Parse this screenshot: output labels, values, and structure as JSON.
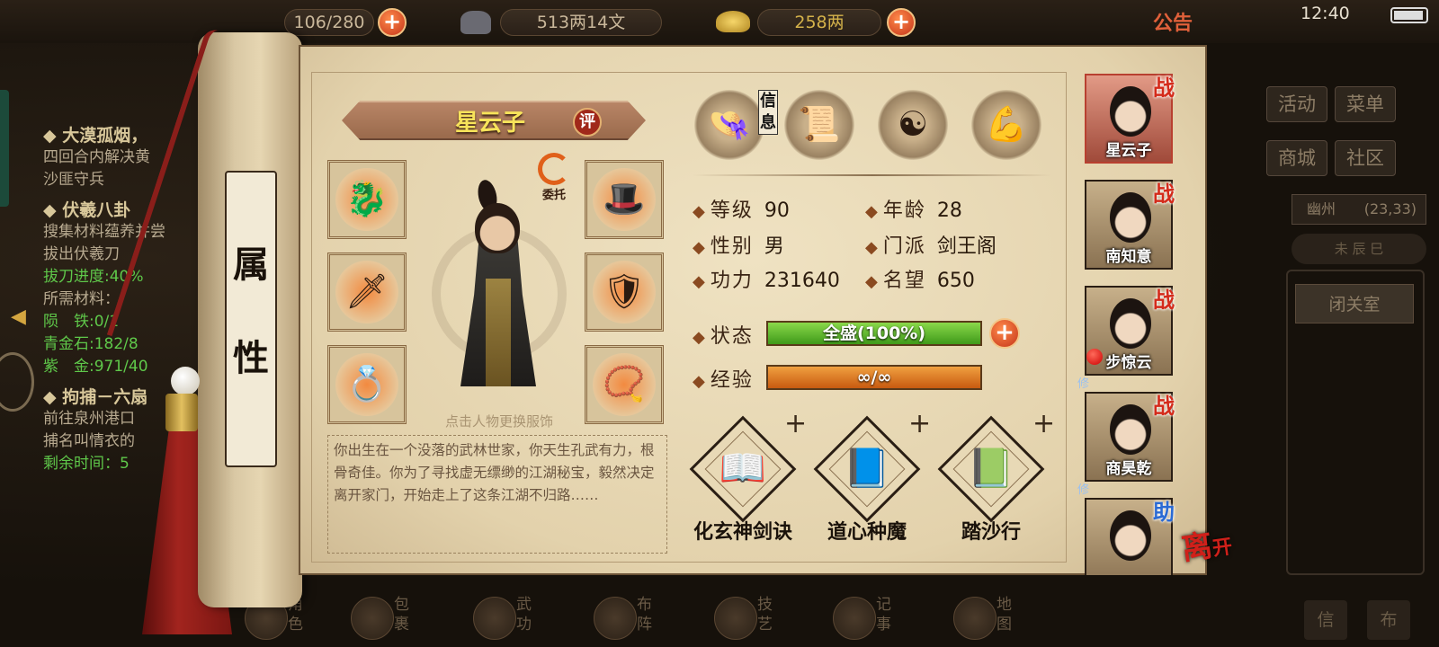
{
  "topbar": {
    "stamina": "106/280",
    "coins": "513两14文",
    "gold": "258两",
    "notice": "公告",
    "time": "12:40"
  },
  "quests": [
    {
      "title": "◆ 大漠孤烟，",
      "lines": [
        "四回合内解决黄",
        "沙匪守兵"
      ]
    },
    {
      "title": "◆ 伏羲八卦",
      "lines": [
        "搜集材料蕴养并尝",
        "拔出伏羲刀"
      ],
      "green_lines": [
        "拔刀进度:40%"
      ],
      "after": [
        "所需材料："
      ],
      "materials": [
        "陨　铁:0/1",
        "青金石:182/8",
        "紫　金:971/40"
      ]
    },
    {
      "title": "◆ 拘捕－六扇",
      "lines": [
        "前往泉州港口",
        "捕名叫情衣的"
      ],
      "timer": "剩余时间：5"
    }
  ],
  "side_menu": {
    "activity": "活动",
    "menu": "菜单",
    "shop": "商城",
    "community": "社区",
    "location_name": "幽州",
    "location_coords": "(23,33)",
    "shichen": "未 辰 巳",
    "seclusion": "闭关室",
    "letter": "信",
    "bag": "布"
  },
  "bottom_nav": [
    "角色",
    "包裹",
    "武功",
    "布阵",
    "技艺",
    "记事",
    "地图"
  ],
  "scroll_label": [
    "属",
    "性"
  ],
  "character": {
    "name": "星云子",
    "rate_label": "评",
    "entrust_label": "委托",
    "change_hint": "点击人物更换服饰",
    "bio": "你出生在一个没落的武林世家，你天生孔武有力，根骨奇佳。你为了寻找虚无缥缈的江湖秘宝，毅然决定离开家门，开始走上了这条江湖不归路……"
  },
  "tabs": {
    "info_label": "信息",
    "icons": [
      "info-hat-icon",
      "scroll-manual-icon",
      "bagua-icon",
      "meridian-body-icon"
    ]
  },
  "stats": {
    "level_label": "等级",
    "level": "90",
    "age_label": "年龄",
    "age": "28",
    "gender_label": "性别",
    "gender": "男",
    "sect_label": "门派",
    "sect": "剑王阁",
    "power_label": "功力",
    "power": "231640",
    "fame_label": "名望",
    "fame": "650",
    "state_label": "状态",
    "state": "全盛(100%)",
    "state_pct": 100,
    "exp_label": "经验",
    "exp": "∞/∞",
    "exp_pct": 100
  },
  "skills": [
    {
      "name": "化玄神剑诀",
      "icon": "book-icon"
    },
    {
      "name": "道心种魔",
      "icon": "scroll-icon"
    },
    {
      "name": "踏沙行",
      "icon": "jade-scroll-icon"
    }
  ],
  "team": [
    {
      "name": "星云子",
      "badge": "战",
      "selected": true
    },
    {
      "name": "南知意",
      "badge": "战"
    },
    {
      "name": "步惊云",
      "badge": "战",
      "xiu": "修"
    },
    {
      "name": "商昊乾",
      "badge": "战",
      "xiu": "修"
    },
    {
      "name": "",
      "badge": "助"
    }
  ],
  "leave": {
    "big": "离",
    "small": "开"
  },
  "colors": {
    "state_bar": "#5cb82a",
    "exp_bar": "#e07a1a",
    "accent": "#c4341a"
  }
}
